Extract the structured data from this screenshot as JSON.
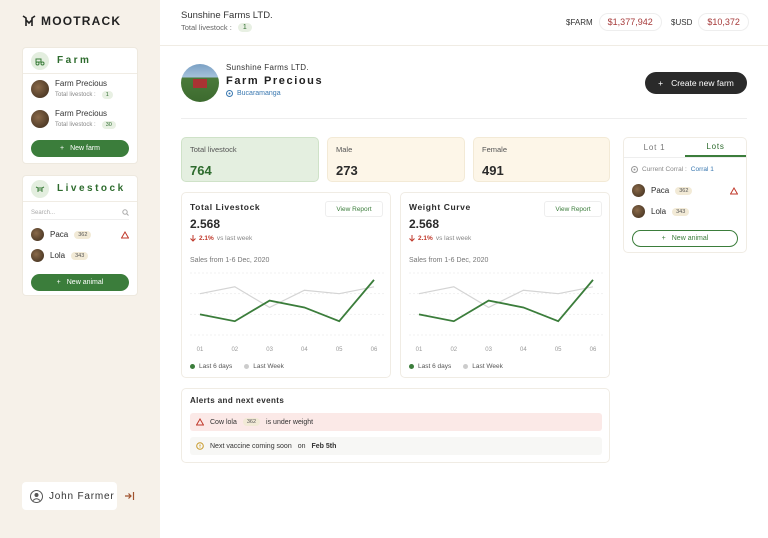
{
  "brand": {
    "name": "MOOTRACK"
  },
  "sidebar": {
    "farm_card": {
      "title": "Farm",
      "items": [
        {
          "name": "Farm Precious",
          "livestock_label": "Total livestock :",
          "count": "1"
        },
        {
          "name": "Farm Precious",
          "livestock_label": "Total livestock :",
          "count": "30"
        }
      ],
      "button": "New farm"
    },
    "livestock_card": {
      "title": "Livestock",
      "search_placeholder": "Search...",
      "animals": [
        {
          "name": "Paca",
          "tag": "362",
          "alert": true
        },
        {
          "name": "Lola",
          "tag": "343",
          "alert": false
        }
      ],
      "button": "New animal"
    },
    "user": {
      "name": "John Farmer"
    }
  },
  "topbar": {
    "company": "Sunshine Farms LTD.",
    "total_livestock_label": "Total livestock :",
    "total_livestock_value": "1",
    "farm_currency_label": "$FARM",
    "farm_currency_value": "$1,377,942",
    "usd_label": "$USD",
    "usd_value": "$10,372"
  },
  "profile": {
    "company": "Sunshine Farms LTD.",
    "farm_name": "Farm Precious",
    "location": "Bucaramanga",
    "create_button": "Create new farm"
  },
  "stats": [
    {
      "label": "Total livestock",
      "value": "764"
    },
    {
      "label": "Male",
      "value": "273"
    },
    {
      "label": "Female",
      "value": "491"
    }
  ],
  "panels": [
    {
      "title": "Total Livestock",
      "value": "2.568",
      "delta": "2.1%",
      "delta_text": "vs last week",
      "button": "View Report",
      "subtitle": "Sales from 1-6 Dec, 2020"
    },
    {
      "title": "Weight Curve",
      "value": "2.568",
      "delta": "2.1%",
      "delta_text": "vs last week",
      "button": "View Report",
      "subtitle": "Sales from 1-6 Dec, 2020"
    }
  ],
  "chart_data": [
    {
      "type": "line",
      "categories": [
        "01",
        "02",
        "03",
        "04",
        "05",
        "06"
      ],
      "series": [
        {
          "name": "Last 6 days",
          "values": [
            3,
            2,
            5,
            4,
            2,
            8
          ]
        },
        {
          "name": "Last Week",
          "values": [
            6,
            7,
            4,
            6.5,
            6,
            7
          ]
        }
      ],
      "legend": "bottom"
    },
    {
      "type": "line",
      "categories": [
        "01",
        "02",
        "03",
        "04",
        "05",
        "06"
      ],
      "series": [
        {
          "name": "Last 6 days",
          "values": [
            3,
            2,
            5,
            4,
            2,
            8
          ]
        },
        {
          "name": "Last Week",
          "values": [
            6,
            7,
            4,
            6.5,
            6,
            7
          ]
        }
      ],
      "legend": "bottom"
    }
  ],
  "colors": {
    "current": "#3b7d3b",
    "previous": "#d4d4d4",
    "accent": "#3b7d3b"
  },
  "alerts": {
    "title": "Alerts and next events",
    "weight_alert": {
      "prefix": "Cow lola",
      "tag": "362",
      "suffix": "is under weight"
    },
    "event": {
      "prefix": "Next vaccine coming soon",
      "on": "on",
      "date": "Feb 5th"
    }
  },
  "lots": {
    "tabs": [
      "Lot 1",
      "Lots"
    ],
    "active_tab": 1,
    "corral_label": "Current Corral :",
    "corral_value": "Corral 1",
    "animals": [
      {
        "name": "Paca",
        "tag": "362",
        "alert": true
      },
      {
        "name": "Lola",
        "tag": "343",
        "alert": false
      }
    ],
    "button": "New animal"
  }
}
